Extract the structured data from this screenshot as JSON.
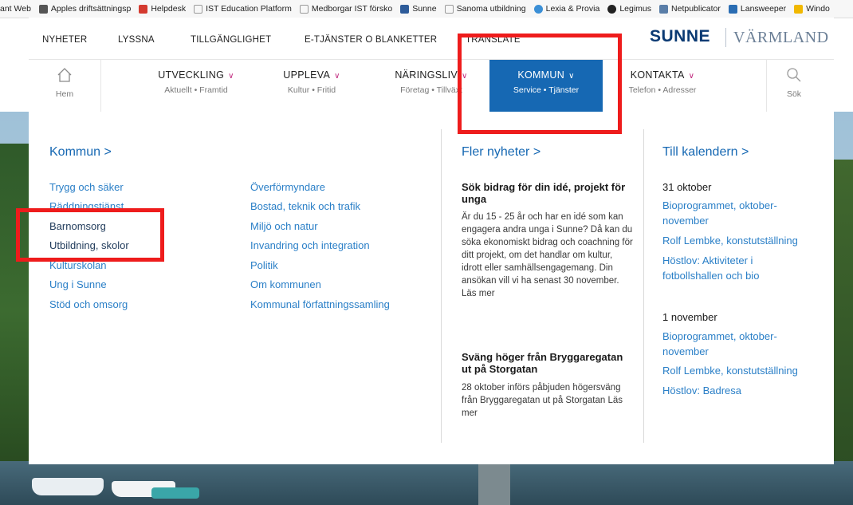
{
  "bookmarks": [
    {
      "label": "ant Web",
      "color": "#ffffff"
    },
    {
      "label": "Apples driftsättningsp",
      "color": "#555555"
    },
    {
      "label": "Helpdesk",
      "color": "#d43a2f"
    },
    {
      "label": "IST Education Platform",
      "color": "#9a9a9a"
    },
    {
      "label": "Medborgar IST försko",
      "color": "#9a9a9a"
    },
    {
      "label": "Sunne",
      "color": "#2e5c9a"
    },
    {
      "label": "Sanoma utbildning",
      "color": "#9a9a9a"
    },
    {
      "label": "Lexia & Provia",
      "color": "#3b8fd6"
    },
    {
      "label": "Legimus",
      "color": "#222222"
    },
    {
      "label": "Netpublicator",
      "color": "#5a7ea8"
    },
    {
      "label": "Lansweeper",
      "color": "#2a6db3"
    },
    {
      "label": "Windo",
      "color": "#f1b800"
    }
  ],
  "topnav": {
    "nyheter": "NYHETER",
    "lyssna": "LYSSNA",
    "tillganglighet": "TILLGÄNGLIGHET",
    "etjanster": "E-TJÄNSTER O BLANKETTER",
    "translate": "TRANSLATE",
    "logo_main": "SUNNE",
    "logo_sub": "VÄRMLAND"
  },
  "mainnav": {
    "home": "Hem",
    "search": "Sök",
    "items": [
      {
        "title": "UTVECKLING",
        "sub": "Aktuellt • Framtid"
      },
      {
        "title": "UPPLEVA",
        "sub": "Kultur • Fritid"
      },
      {
        "title": "NÄRINGSLIV",
        "sub": "Företag • Tillväxt"
      },
      {
        "title": "KOMMUN",
        "sub": "Service • Tjänster"
      },
      {
        "title": "KONTAKTA",
        "sub": "Telefon • Adresser"
      }
    ]
  },
  "kommun": {
    "title": "Kommun >",
    "col1": [
      "Trygg och säker",
      "Räddningstjänst",
      "Barnomsorg",
      "Utbildning, skolor",
      "Kulturskolan",
      "Ung i Sunne",
      "Stöd och omsorg"
    ],
    "col2": [
      "Överförmyndare",
      "Bostad, teknik och trafik",
      "Miljö och natur",
      "Invandring och integration",
      "Politik",
      "Om kommunen",
      "Kommunal författningssamling"
    ]
  },
  "news": {
    "title": "Fler nyheter >",
    "items": [
      {
        "headline": "Sök bidrag för din idé, projekt för unga",
        "body": "Är du 15 - 25 år och har en idé som kan engagera andra unga i Sunne? Då kan du söka ekonomiskt bidrag och coachning för ditt projekt, om det handlar om kultur, idrott eller samhällsengagemang. Din ansökan vill vi ha senast 30 november. Läs mer"
      },
      {
        "headline": "Sväng höger från Bryggaregatan ut på Storgatan",
        "body": "28 oktober införs påbjuden högersväng från Bryggaregatan ut på Storgatan Läs mer"
      }
    ]
  },
  "calendar": {
    "title": "Till kalendern >",
    "days": [
      {
        "date": "31 oktober",
        "events": [
          "Bioprogrammet, oktober-november",
          "Rolf Lembke, konstutställning",
          "Höstlov: Aktiviteter i fotbollshallen och bio"
        ]
      },
      {
        "date": "1 november",
        "events": [
          "Bioprogrammet, oktober-november",
          "Rolf Lembke, konstutställning",
          "Höstlov: Badresa"
        ]
      }
    ]
  },
  "colors": {
    "accent": "#1668b3",
    "link": "#2a7fc7",
    "highlight": "#ee1c1c",
    "chevron": "#c0287d"
  }
}
